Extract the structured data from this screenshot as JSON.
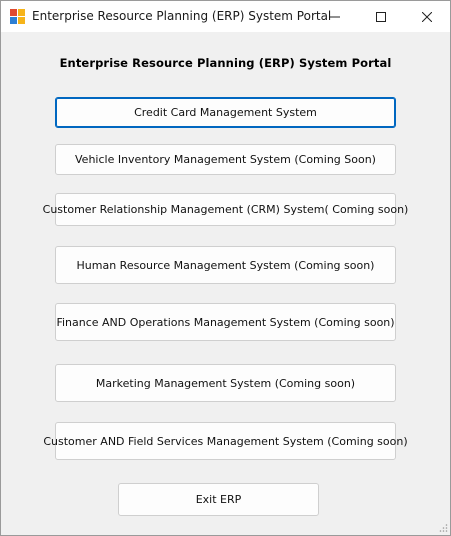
{
  "window": {
    "title": "Enterprise Resource Planning (ERP) System Portal",
    "icon": "winforms-app-icon",
    "controls": [
      "minimize-icon",
      "maximize-icon",
      "close-icon"
    ]
  },
  "main": {
    "heading": "Enterprise Resource Planning (ERP) System Portal",
    "buttons": [
      {
        "label": "Credit Card Management System"
      },
      {
        "label": "Vehicle Inventory Management System (Coming Soon)"
      },
      {
        "label": "Customer Relationship Management (CRM) System( Coming soon)"
      },
      {
        "label": "Human Resource Management System (Coming soon)"
      },
      {
        "label": "Finance AND Operations Management System (Coming soon)"
      },
      {
        "label": "Marketing Management System (Coming soon)"
      },
      {
        "label": "Customer AND Field Services Management System (Coming soon)"
      }
    ],
    "exit_label": "Exit ERP"
  },
  "colors": {
    "focus_border": "#0067c0",
    "window_bg": "#f0f0f0",
    "button_bg": "#fdfdfd"
  }
}
